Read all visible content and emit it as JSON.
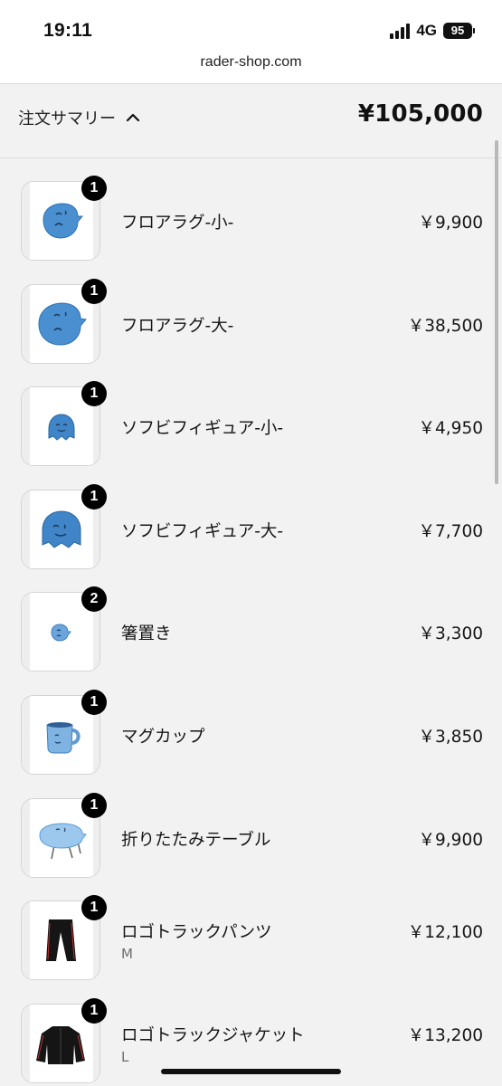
{
  "status_bar": {
    "time": "19:11",
    "network": "4G",
    "battery": "95",
    "signal_icon": "signal-bars-icon",
    "battery_icon": "battery-icon"
  },
  "browser": {
    "url": "rader-shop.com"
  },
  "summary": {
    "label": "注文サマリー",
    "toggle_icon": "chevron-up-icon",
    "total": "¥105,000"
  },
  "items": [
    {
      "name": "フロアラグ-小-",
      "price": "￥9,900",
      "quantity": "1",
      "variant": "",
      "image": "small-floor-rug"
    },
    {
      "name": "フロアラグ-大-",
      "price": "￥38,500",
      "quantity": "1",
      "variant": "",
      "image": "large-floor-rug"
    },
    {
      "name": "ソフビフィギュア-小-",
      "price": "￥4,950",
      "quantity": "1",
      "variant": "",
      "image": "small-vinyl-figure"
    },
    {
      "name": "ソフビフィギュア-大-",
      "price": "￥7,700",
      "quantity": "1",
      "variant": "",
      "image": "large-vinyl-figure"
    },
    {
      "name": "箸置き",
      "price": "￥3,300",
      "quantity": "2",
      "variant": "",
      "image": "chopstick-rest"
    },
    {
      "name": "マグカップ",
      "price": "￥3,850",
      "quantity": "1",
      "variant": "",
      "image": "mug-cup"
    },
    {
      "name": "折りたたみテーブル",
      "price": "￥9,900",
      "quantity": "1",
      "variant": "",
      "image": "folding-table"
    },
    {
      "name": "ロゴトラックパンツ",
      "price": "￥12,100",
      "quantity": "1",
      "variant": "M",
      "image": "track-pants"
    },
    {
      "name": "ロゴトラックジャケット",
      "price": "￥13,200",
      "quantity": "1",
      "variant": "L",
      "image": "track-jacket"
    }
  ]
}
